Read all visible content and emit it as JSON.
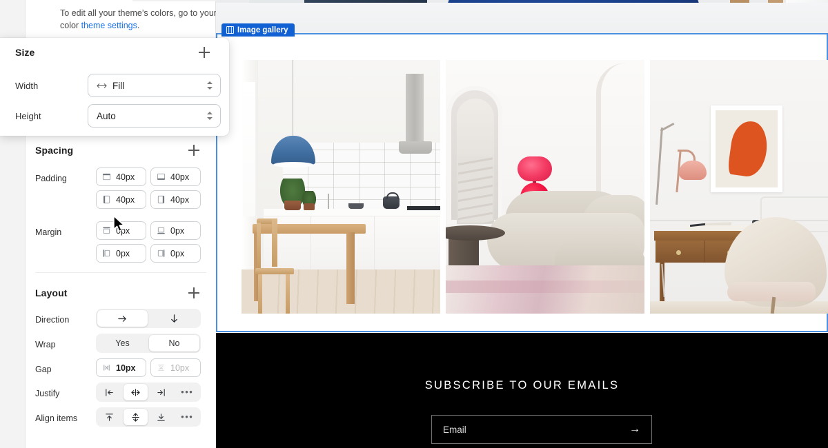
{
  "editor": {
    "theme_note": {
      "text_before": "To edit all your theme’s colors, go to your color ",
      "link": "theme settings",
      "text_after": "."
    },
    "size_section": {
      "title": "Size",
      "add_label": "+",
      "fields": [
        {
          "label": "Width",
          "value": "Fill",
          "icon": "horizontal-resize-icon"
        },
        {
          "label": "Height",
          "value": "Auto",
          "icon": ""
        }
      ]
    },
    "spacing_section": {
      "title": "Spacing",
      "add_label": "+",
      "padding": {
        "label": "Padding",
        "values": [
          {
            "icon": "padding-top-icon",
            "value": "40px"
          },
          {
            "icon": "padding-bottom-icon",
            "value": "40px"
          },
          {
            "icon": "padding-left-icon",
            "value": "40px"
          },
          {
            "icon": "padding-right-icon",
            "value": "40px"
          }
        ]
      },
      "margin": {
        "label": "Margin",
        "values": [
          {
            "icon": "margin-top-icon",
            "value": "0px"
          },
          {
            "icon": "margin-bottom-icon",
            "value": "0px"
          },
          {
            "icon": "margin-left-icon",
            "value": "0px"
          },
          {
            "icon": "margin-right-icon",
            "value": "0px"
          }
        ]
      }
    },
    "layout_section": {
      "title": "Layout",
      "add_label": "+",
      "direction": {
        "label": "Direction",
        "options": [
          {
            "icon": "arrow-right-icon",
            "selected": true
          },
          {
            "icon": "arrow-down-icon",
            "selected": false
          }
        ]
      },
      "wrap": {
        "label": "Wrap",
        "options": [
          {
            "label": "Yes",
            "selected": false
          },
          {
            "label": "No",
            "selected": true
          }
        ]
      },
      "gap": {
        "label": "Gap",
        "values": [
          {
            "icon": "gap-horizontal-icon",
            "value": "10px",
            "enabled": true
          },
          {
            "icon": "gap-vertical-icon",
            "value": "10px",
            "enabled": false
          }
        ]
      },
      "justify": {
        "label": "Justify",
        "options": [
          {
            "icon": "justify-start-icon",
            "selected": false
          },
          {
            "icon": "justify-center-icon",
            "selected": true
          },
          {
            "icon": "justify-end-icon",
            "selected": false
          },
          {
            "icon": "more-options-icon",
            "selected": false
          }
        ]
      },
      "align_items": {
        "label": "Align items",
        "options": [
          {
            "icon": "align-top-icon",
            "selected": false
          },
          {
            "icon": "align-center-icon",
            "selected": true
          },
          {
            "icon": "align-bottom-icon",
            "selected": false
          },
          {
            "icon": "more-options-icon",
            "selected": false
          }
        ]
      }
    }
  },
  "preview": {
    "selected_section_badge": "Image gallery",
    "gallery": {
      "images": [
        {
          "alt": "White kitchen with blue pendant lamp and wooden dining table"
        },
        {
          "alt": "Living room with red glass lamp and cream boucle sofa"
        },
        {
          "alt": "Home office with orange teardrop artwork, pink lamp and wooden desk"
        }
      ]
    },
    "top_banner": {
      "alt": "Blue lounge chair and navy cube in a white room"
    },
    "footer": {
      "title": "SUBSCRIBE TO OUR EMAILS",
      "email_placeholder": "Email",
      "email_value": "",
      "submit_icon": "→"
    }
  },
  "colors": {
    "accent_blue": "#1161d4",
    "selection_blue": "#4a90e2",
    "link_blue": "#1a73e8",
    "footer_bg": "#000000"
  }
}
